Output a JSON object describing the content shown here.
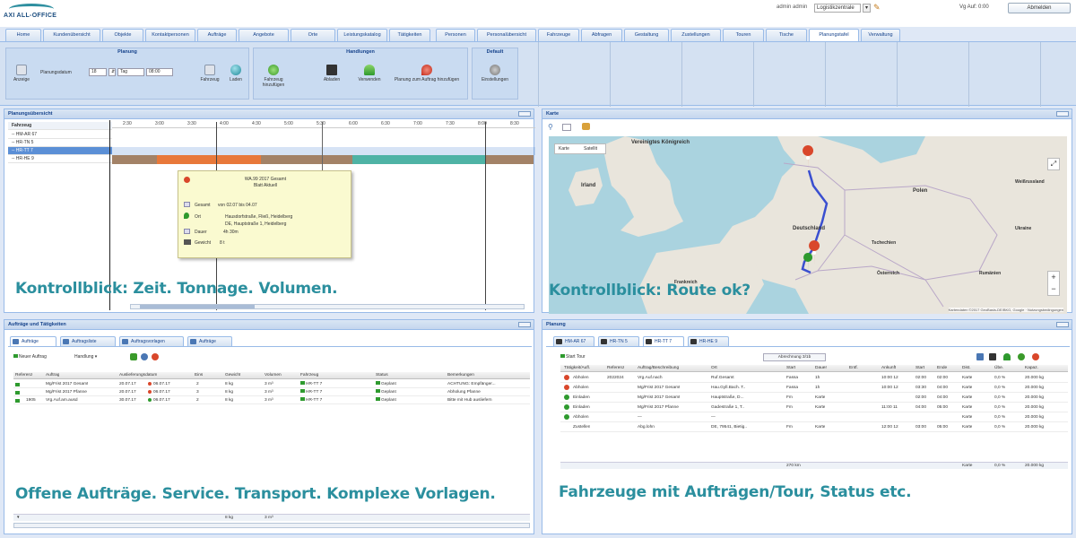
{
  "header": {
    "logo_text": "AXI ALL-OFFICE",
    "user_label": "admin admin",
    "user_select": "Logistikzentrale",
    "login_info": "Vg Auf: 0:00",
    "logout_label": "Abmelden"
  },
  "tabs": [
    {
      "label": "Home"
    },
    {
      "label": "Kundenübersicht"
    },
    {
      "label": "Objekte"
    },
    {
      "label": "Kontaktpersonen"
    },
    {
      "label": "Aufträge"
    },
    {
      "label": "Angebote"
    },
    {
      "label": "Orte"
    },
    {
      "label": "Leistungskatalog"
    },
    {
      "label": "Tätigkeiten"
    },
    {
      "label": "Personen"
    },
    {
      "label": "Personalübersicht"
    },
    {
      "label": "Fahrzeuge"
    },
    {
      "label": "Abfragen"
    },
    {
      "label": "Gestaltung"
    },
    {
      "label": "Zustellungen"
    },
    {
      "label": "Touren"
    },
    {
      "label": "Tische"
    },
    {
      "label": "Planungstafel"
    },
    {
      "label": "Verwaltung"
    }
  ],
  "ribbon": {
    "group_planung": "Planung",
    "group_handlung": "Handlungen",
    "group_default": "Default",
    "btn_anzeige": "Anzeige",
    "period_label": "Planungsdatum",
    "combo_day": "18",
    "combo_unit": "Tag",
    "combo_time": "08:00",
    "btn_fahrzeug": "Fahrzeug",
    "btn_laden": "Laden",
    "btn_fahrzeug_hinzu": "Fahrzeug hinzufügen",
    "btn_abladen": "Abladen",
    "btn_verwenden": "Verwenden",
    "btn_planung_auftrag": "Planung zum Auftrag hinzufügen",
    "btn_einstellungen": "Einstellungen"
  },
  "gantt_panel": {
    "title": "Planungsübersicht",
    "col_label": "Fahrzeug",
    "ticks": [
      "2:30",
      "3:00",
      "3:30",
      "4:00",
      "4:30",
      "5:00",
      "5:30",
      "6:00",
      "6:30",
      "7:00",
      "7:30",
      "8:00",
      "8:30"
    ],
    "rows": [
      {
        "label": "-- HM-AR 67"
      },
      {
        "label": "-- HR-TN 5"
      },
      {
        "label": "-- HR-TT 7"
      },
      {
        "label": "-- HR-HE 9"
      }
    ],
    "tooltip": {
      "title": "WA.99 2017 Gesamt",
      "subtitle": "Blatt Aktuell",
      "row1_label": "Gesamt",
      "row1_value": "von 02.07 bis 04.07",
      "row2_label": "Ort",
      "row2_value": "Hausdorfstraße, Fließ, Heidelberg",
      "row2_value2": "DE, Hauptstraße 1, Heidelberg",
      "row3_label": "Dauer",
      "row3_value": "4h 30m",
      "row4_label": "Gewicht",
      "row4_value": "8 t"
    },
    "caption": "Kontrollblick: Zeit. Tonnage. Volumen."
  },
  "map_panel": {
    "title": "Karte",
    "map_btn": "Karte",
    "sat_btn": "Satellit",
    "labels": {
      "uk": "Vereinigtes Königreich",
      "ireland": "Irland",
      "germany": "Deutschland",
      "poland": "Polen",
      "belarus": "Weißrussland",
      "ukraine": "Ukraine",
      "czech": "Tschechien",
      "france": "Frankreich",
      "austria": "Österreich",
      "romania": "Rumänien"
    },
    "footer": "Kartendaten ©2017 GeoBasis-DE/BKG, Google · Nutzungsbedingungen",
    "caption": "Kontrollblick: Route ok?"
  },
  "orders_panel": {
    "title": "Aufträge und Tätigkeiten",
    "subtabs": [
      "Aufträge",
      "Auftragsliste",
      "Auftragsvorlagen",
      "Aufträge"
    ],
    "new_order_btn": "Neuer Auftrag",
    "filter_btn": "Handlung",
    "columns": [
      "Referenz",
      "Auftrag",
      "Auslieferungsdatum",
      "Eins",
      "Gewicht",
      "Volumen",
      "Fahrzeug",
      "Status",
      "Bemerkungen"
    ],
    "rows": [
      {
        "ref": "",
        "auftrag": "Mg/Frist 2017 Gesamt",
        "date": "20.07.17",
        "date2": "06.07.17",
        "eins": "2",
        "gew": "8 kg",
        "vol": "3 m³",
        "fz": "HR-TT 7",
        "status": "Geplant",
        "bem": "ACHTUNG: Empfänger..."
      },
      {
        "ref": "",
        "auftrag": "Mg/Frist 2017 Pfanne",
        "date": "20.07.17",
        "date2": "06.07.17",
        "eins": "3",
        "gew": "8 kg",
        "vol": "3 m³",
        "fz": "HR-TT 7",
        "status": "Geplant",
        "bem": "Abholung Pfanne"
      },
      {
        "ref": "1905",
        "auftrag": "Vrg.Auf.am.ausd",
        "date": "30.07.17",
        "date2": "06.07.17",
        "eins": "2",
        "gew": "8 kg",
        "vol": "3 m³",
        "fz": "HR-TT 7",
        "status": "Geplant",
        "bem": "Bitte mit Hub ausliefern"
      }
    ],
    "footer_gew": "8 kg",
    "footer_vol": "3 m³",
    "caption": "Offene Aufträge. Service. Transport. Komplexe Vorlagen."
  },
  "planning_panel": {
    "title": "Planung",
    "subtabs": [
      "HM-AR 67",
      "HR-TN 5",
      "HR-TT 7",
      "HR-HE 9"
    ],
    "toolbar_btn": "Start Tour",
    "toolbar_select": "Abrechnung 3/1b",
    "columns": [
      "Tätigkeit/Aufl.",
      "Referenz",
      "Auftrag/Beschreibung",
      "Ort",
      "Start",
      "Dauer",
      "Entf.",
      "Ankunft",
      "Start",
      "Ende",
      "Dist.",
      "Übe.",
      "Kapaz."
    ],
    "rows": [
      {
        "color": "#d9472b",
        "act": "Abholen",
        "ref": "2022024",
        "desc": "Vrg.Auf.nach",
        "ort": "Ruf.Gesamt",
        "start": "Fassa",
        "dur": "1h",
        "entf": "",
        "ank": "10:00 12",
        "s": "02:00",
        "e": "02:00",
        "dist": "Karte",
        "ube": "0,0 %",
        "kap": "20.000 kg"
      },
      {
        "color": "#d9472b",
        "act": "Abholen",
        "ref": "",
        "desc": "Mg/Frist 2017 Gesamt",
        "ort": "Hau.Gyll.Bach. T..",
        "start": "Fassa",
        "dur": "1h",
        "entf": "",
        "ank": "10:00 12",
        "s": "03:30",
        "e": "04:00",
        "dist": "Karte",
        "ube": "0,0 %",
        "kap": "20.000 kg"
      },
      {
        "color": "#2e9a2e",
        "act": "Einladen",
        "ref": "",
        "desc": "Mg/Frist 2017 Gesamt",
        "ort": "Hauptstraße, D...",
        "start": "Fm",
        "dur": "Karte",
        "entf": "",
        "ank": "",
        "s": "02:00",
        "e": "04:00",
        "dist": "Karte",
        "ube": "0,0 %",
        "kap": "20.000 kg"
      },
      {
        "color": "#2e9a2e",
        "act": "Einladen",
        "ref": "",
        "desc": "Mg/Frist 2017 Pfanne",
        "ort": "Gadestraße 1, T..",
        "start": "Fm",
        "dur": "Karte",
        "entf": "",
        "ank": "11:00 11",
        "s": "04:00",
        "e": "05:00",
        "dist": "Karte",
        "ube": "0,0 %",
        "kap": "20.000 kg"
      },
      {
        "color": "#2e9a2e",
        "act": "Abholen",
        "ref": "",
        "desc": "—",
        "ort": "—",
        "start": "",
        "dur": "",
        "entf": "",
        "ank": "",
        "s": "",
        "e": "",
        "dist": "Karte",
        "ube": "0,0 %",
        "kap": "20.000 kg"
      },
      {
        "color": "",
        "act": "Zustellen",
        "ref": "",
        "desc": "Abg.lohn",
        "ort": "DE, 79541, Bietig..",
        "start": "Fm",
        "dur": "Karte",
        "entf": "",
        "ank": "12:00 12",
        "s": "03:00",
        "e": "05:00",
        "dist": "Karte",
        "ube": "0,0 %",
        "kap": "20.000 kg"
      }
    ],
    "footer": {
      "start": "270 km",
      "dist": "Karte",
      "ube": "0,0 %",
      "kap": "20.000 kg"
    },
    "caption": "Fahrzeuge mit Aufträgen/Tour, Status etc."
  },
  "colors": {
    "accent": "#2b8f9e",
    "brand_blue": "#15428b",
    "gantt_brown": "#a38267",
    "gantt_orange": "#e8783a",
    "gantt_teal": "#4fb3a5",
    "route": "#3a4fd0"
  }
}
